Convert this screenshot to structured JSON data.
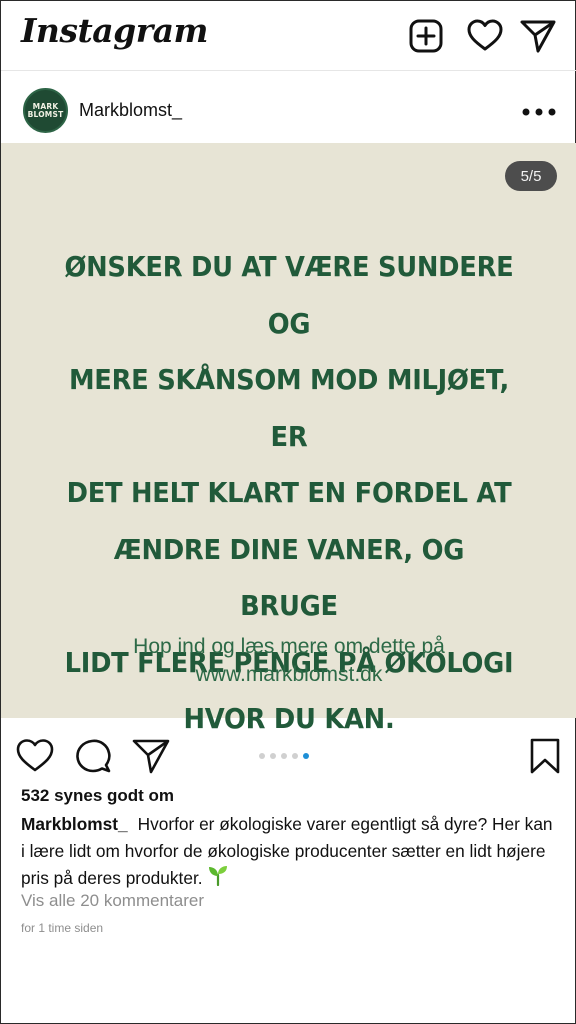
{
  "app": {
    "logo": "Instagram"
  },
  "topbar": {
    "icons": [
      "new-post-icon",
      "heart-icon",
      "send-icon"
    ]
  },
  "post": {
    "username": "Markblomst_",
    "avatar_text": [
      "MARK",
      "BLOMST"
    ],
    "counter": "5/5",
    "headline": "ØNSKER DU AT VÆRE SUNDERE OG MERE SKÅNSOM MOD MILJØET, ER DET HELT KLART EN FORDEL AT ÆNDRE DINE VANER, OG BRUGE LIDT FLERE PENGE PÅ ØKOLOGI HVOR DU KAN.",
    "headline_lines": [
      "ØNSKER DU AT VÆRE SUNDERE OG",
      "MERE SKÅNSOM MOD MILJØET, ER",
      "DET HELT KLART EN FORDEL AT",
      "ÆNDRE DINE VANER, OG BRUGE",
      "LIDT FLERE PENGE PÅ ØKOLOGI",
      "HVOR DU KAN."
    ],
    "subline_lines": [
      "Hop ind og læs mere om dette på",
      "www.markblomst.dk"
    ],
    "colors": {
      "image_bg": "#e7e4d5",
      "headline": "#215a3a",
      "dot_active": "#1e8fd6"
    },
    "carousel": {
      "total": 5,
      "active_index": 4
    }
  },
  "engagement": {
    "likes": "532 synes godt om",
    "caption_user": "Markblomst_",
    "caption_text": "Hvorfor er økologiske varer egentligt så dyre? Her kan i lære lidt om hvorfor de økologiske producenter sætter en lidt højere pris på deres produkter.",
    "caption_emoji": "seedling-icon",
    "comments_link": "Vis alle 20 kommentarer",
    "time": "for 1 time siden"
  }
}
